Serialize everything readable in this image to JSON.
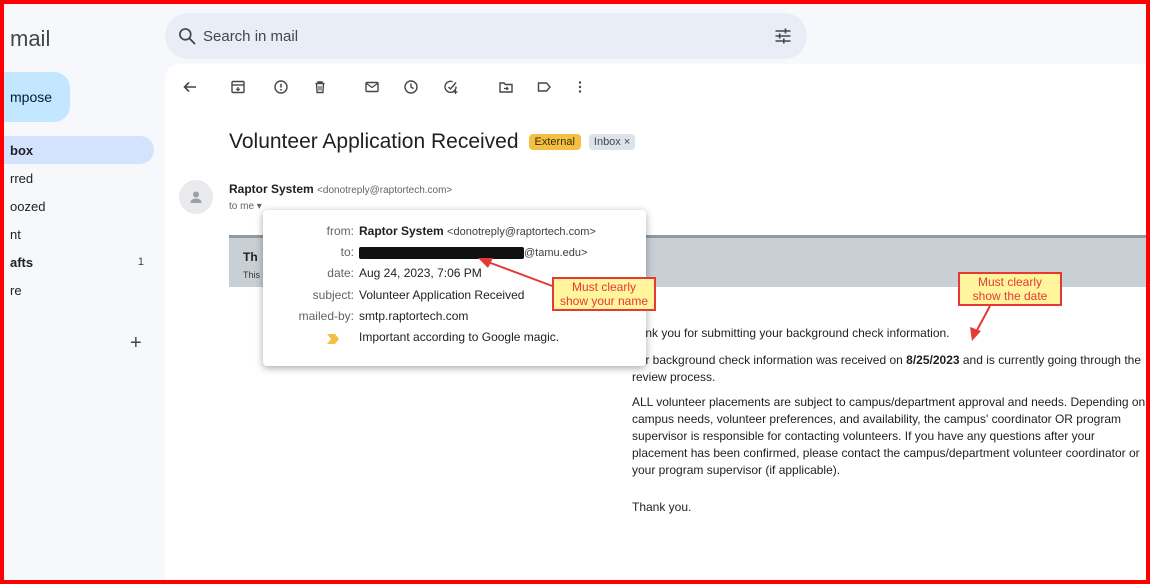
{
  "app": {
    "brand": "mail"
  },
  "search": {
    "placeholder": "Search in mail"
  },
  "sidebar": {
    "compose_label": "mpose",
    "items": [
      {
        "label": "box",
        "count": ""
      },
      {
        "label": "rred",
        "count": ""
      },
      {
        "label": "oozed",
        "count": ""
      },
      {
        "label": "nt",
        "count": ""
      },
      {
        "label": "afts",
        "count": "1"
      },
      {
        "label": "re",
        "count": ""
      }
    ],
    "labels_add": "+"
  },
  "email": {
    "subject": "Volunteer Application Received",
    "badge_external": "External",
    "badge_inbox": "Inbox ×",
    "sender_name": "Raptor System",
    "sender_email": "<donotreply@raptortech.com>",
    "to_me": "to me ▾",
    "preview_title": "Th",
    "preview_snippet": "This"
  },
  "details": {
    "from_key": "from:",
    "from_name": "Raptor System",
    "from_email": "<donotreply@raptortech.com>",
    "to_key": "to:",
    "to_suffix": "@tamu.edu>",
    "date_key": "date:",
    "date_value": "Aug 24, 2023, 7:06 PM",
    "subject_key": "subject:",
    "subject_value": "Volunteer Application Received",
    "mailedby_key": "mailed-by:",
    "mailedby_value": "smtp.raptortech.com",
    "importance_value": "Important according to Google magic."
  },
  "body": {
    "p1": "hank you for submitting your background check information.",
    "p2_pre": "our background check information was received on ",
    "p2_date": "8/25/2023",
    "p2_post": "  and is currently going through the review process.",
    "p3": "ALL volunteer placements are subject to campus/department approval and needs. Depending on campus needs, volunteer preferences, and availability, the campus' coordinator OR program supervisor is responsible for contacting volunteers. If you have any questions after your placement has been confirmed, please contact the campus/department volunteer coordinator or your program supervisor (if applicable).",
    "p4": "Thank you."
  },
  "annotations": {
    "name_line1": "Must clearly",
    "name_line2": "show your name",
    "date_line1": "Must clearly",
    "date_line2": "show the date"
  },
  "colors": {
    "frame": "#ff0000",
    "external_badge": "#f4c043",
    "callout_bg": "#fff59d",
    "callout_border": "#e53935"
  }
}
